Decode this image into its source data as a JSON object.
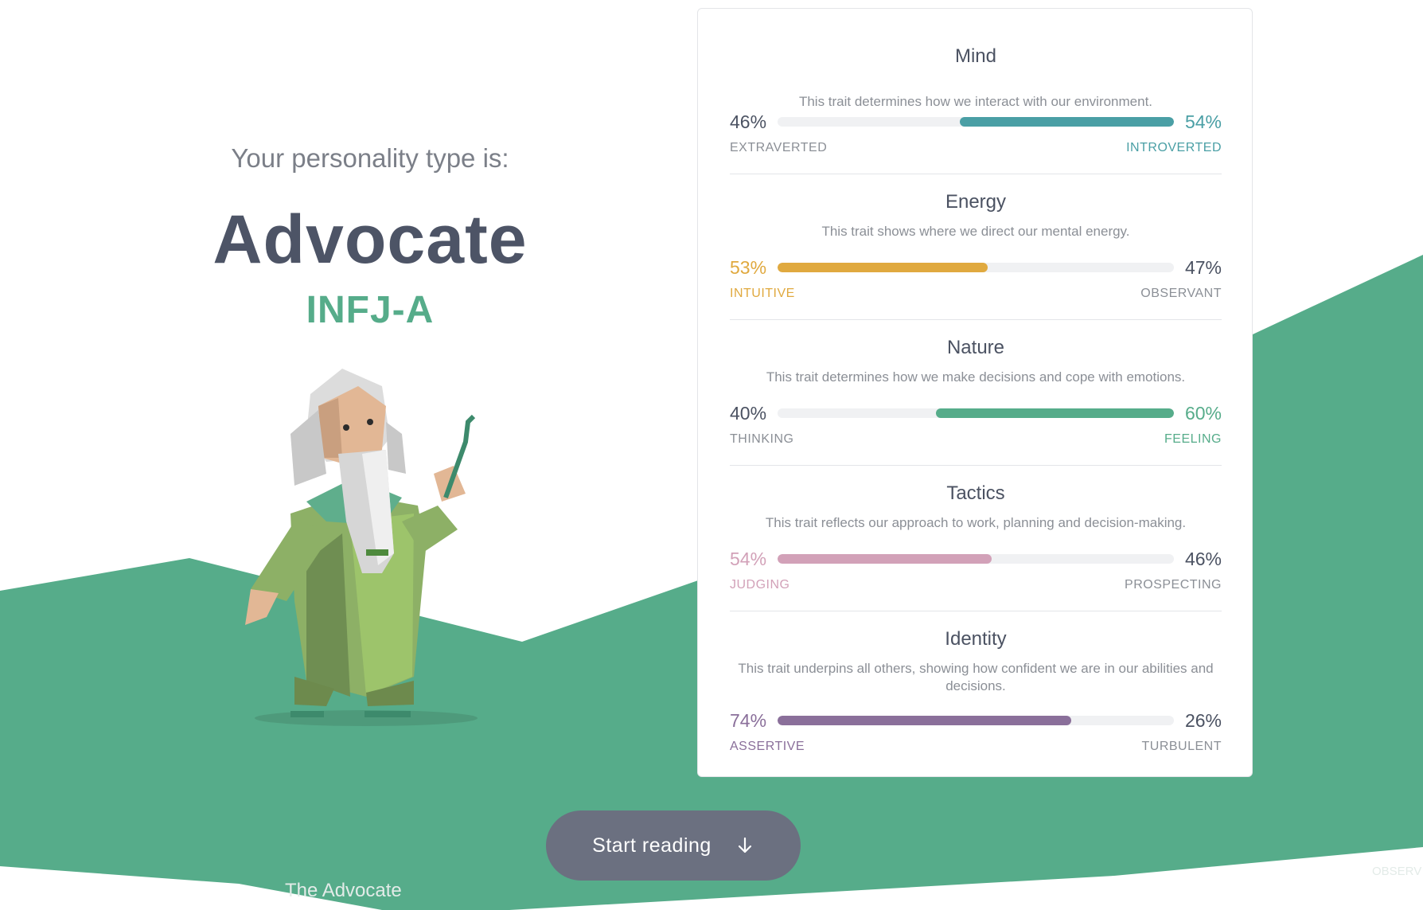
{
  "colors": {
    "background": "#ffffff",
    "band_green": "#56ac8a",
    "heading": "#4d5466",
    "muted": "#7b7f88",
    "button": "#6b7080",
    "mind": "#4a9fa5",
    "energy": "#e0a93f",
    "nature": "#56ac8a",
    "tactics": "#d2a1b8",
    "identity": "#8a6f9a",
    "neutral_text": "#4b5262",
    "neutral_pole": "#8b8f96",
    "track": "#f0f1f3"
  },
  "hero": {
    "intro": "Your personality type is:",
    "type_name": "Advocate",
    "type_code": "INFJ-A",
    "illustration": "advocate-wizard-illustration"
  },
  "traits": [
    {
      "title": "Mind",
      "description": "This trait determines how we interact with our environment.",
      "left": {
        "percent": "46%",
        "label": "EXTRAVERTED"
      },
      "right": {
        "percent": "54%",
        "label": "INTROVERTED"
      },
      "dominant_side": "right",
      "fill_fraction": 0.54,
      "color": "#4a9fa5"
    },
    {
      "title": "Energy",
      "description": "This trait shows where we direct our mental energy.",
      "left": {
        "percent": "53%",
        "label": "INTUITIVE"
      },
      "right": {
        "percent": "47%",
        "label": "OBSERVANT"
      },
      "dominant_side": "left",
      "fill_fraction": 0.53,
      "color": "#e0a93f"
    },
    {
      "title": "Nature",
      "description": "This trait determines how we make decisions and cope with emotions.",
      "left": {
        "percent": "40%",
        "label": "THINKING"
      },
      "right": {
        "percent": "60%",
        "label": "FEELING"
      },
      "dominant_side": "right",
      "fill_fraction": 0.6,
      "color": "#56ac8a"
    },
    {
      "title": "Tactics",
      "description": "This trait reflects our approach to work, planning and decision-making.",
      "left": {
        "percent": "54%",
        "label": "JUDGING"
      },
      "right": {
        "percent": "46%",
        "label": "PROSPECTING"
      },
      "dominant_side": "left",
      "fill_fraction": 0.54,
      "color": "#d2a1b8"
    },
    {
      "title": "Identity",
      "description": "This trait underpins all others, showing how confident we are in our abilities and decisions.",
      "left": {
        "percent": "74%",
        "label": "ASSERTIVE"
      },
      "right": {
        "percent": "26%",
        "label": "TURBULENT"
      },
      "dominant_side": "left",
      "fill_fraction": 0.74,
      "color": "#8a6f9a"
    }
  ],
  "cta": {
    "label": "Start reading",
    "icon": "arrow-down-icon"
  },
  "ghost_text": {
    "bottom_left": "The Advocate",
    "bottom_right": "OBSERV"
  }
}
